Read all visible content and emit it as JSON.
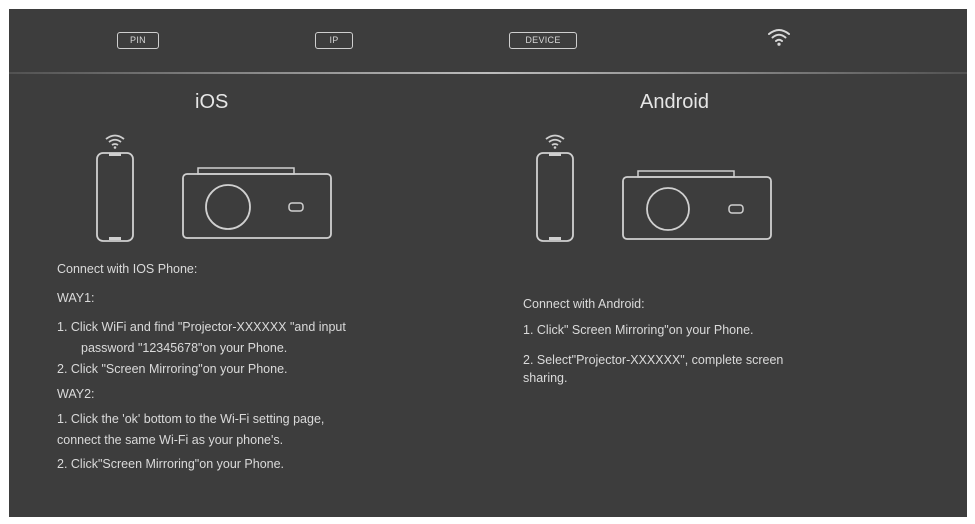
{
  "topbar": {
    "pin_label": "PIN",
    "ip_label": "IP",
    "device_label": "DEVICE",
    "wifi_icon": "wifi-icon"
  },
  "ios": {
    "heading": "iOS",
    "connect_title": "Connect with IOS Phone:",
    "way1_label": "WAY1:",
    "way1_step1_line1": "1. Click WiFi and find \"Projector-XXXXXX \"and input",
    "way1_step1_line2": "password \"12345678\"on your Phone.",
    "way1_step2": "2. Click \"Screen Mirroring\"on your Phone.",
    "way2_label": "WAY2:",
    "way2_step1_line1": "1. Click the 'ok' bottom to the Wi-Fi setting page,",
    "way2_step1_line2": "connect the same Wi-Fi as your phone's.",
    "way2_step2": "2. Click\"Screen Mirroring\"on your Phone."
  },
  "android": {
    "heading": "Android",
    "connect_title": "Connect with Android:",
    "step1": "1. Click\" Screen Mirroring\"on your Phone.",
    "step2_line1": "2. Select\"Projector-XXXXXX\", complete screen",
    "step2_line2": "sharing."
  },
  "colors": {
    "background": "#3d3d3d",
    "text": "#dadada",
    "outline": "#cfcfcf"
  }
}
